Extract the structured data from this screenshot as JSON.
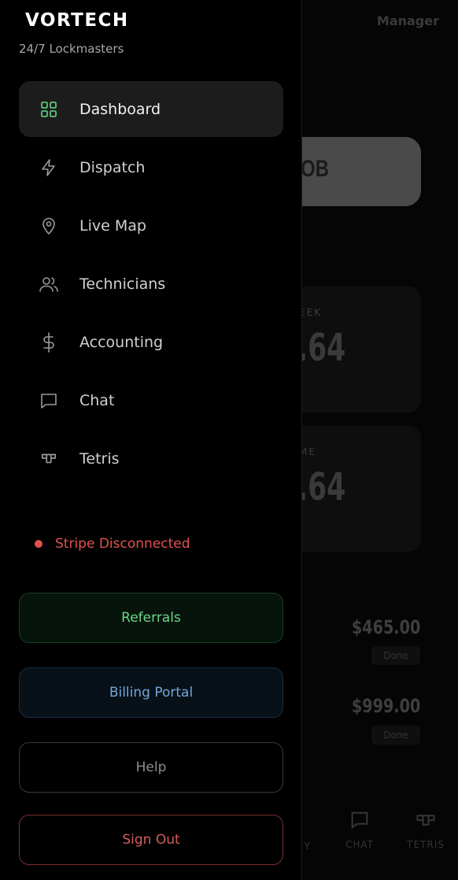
{
  "background": {
    "role": "Manager",
    "job_button_text": "OB",
    "card1": {
      "label": "EEK",
      "value": ".64"
    },
    "card2": {
      "label": "ME",
      "value": ".64"
    },
    "rows": [
      {
        "amount": "$465.00",
        "status": "Done"
      },
      {
        "amount": "$999.00",
        "status": "Done"
      }
    ],
    "bottom_nav": {
      "money": "EY",
      "chat": "CHAT",
      "tetris": "TETRIS"
    }
  },
  "drawer": {
    "brand": "VORTECH",
    "tagline": "24/7 Lockmasters",
    "nav": [
      {
        "label": "Dashboard",
        "icon": "grid-icon",
        "active": true
      },
      {
        "label": "Dispatch",
        "icon": "bolt-icon",
        "active": false
      },
      {
        "label": "Live Map",
        "icon": "map-pin-icon",
        "active": false
      },
      {
        "label": "Technicians",
        "icon": "users-icon",
        "active": false
      },
      {
        "label": "Accounting",
        "icon": "dollar-icon",
        "active": false
      },
      {
        "label": "Chat",
        "icon": "chat-bubble-icon",
        "active": false
      },
      {
        "label": "Tetris",
        "icon": "tetris-icon",
        "active": false
      }
    ],
    "stripe_status": "Stripe Disconnected",
    "buttons": {
      "referrals": "Referrals",
      "billing": "Billing Portal",
      "help": "Help",
      "sign_out": "Sign Out"
    }
  },
  "colors": {
    "active_icon": "#5cc777",
    "error": "#e0524f",
    "referrals_green": "#6ad58a",
    "billing_blue": "#74a6d8"
  }
}
